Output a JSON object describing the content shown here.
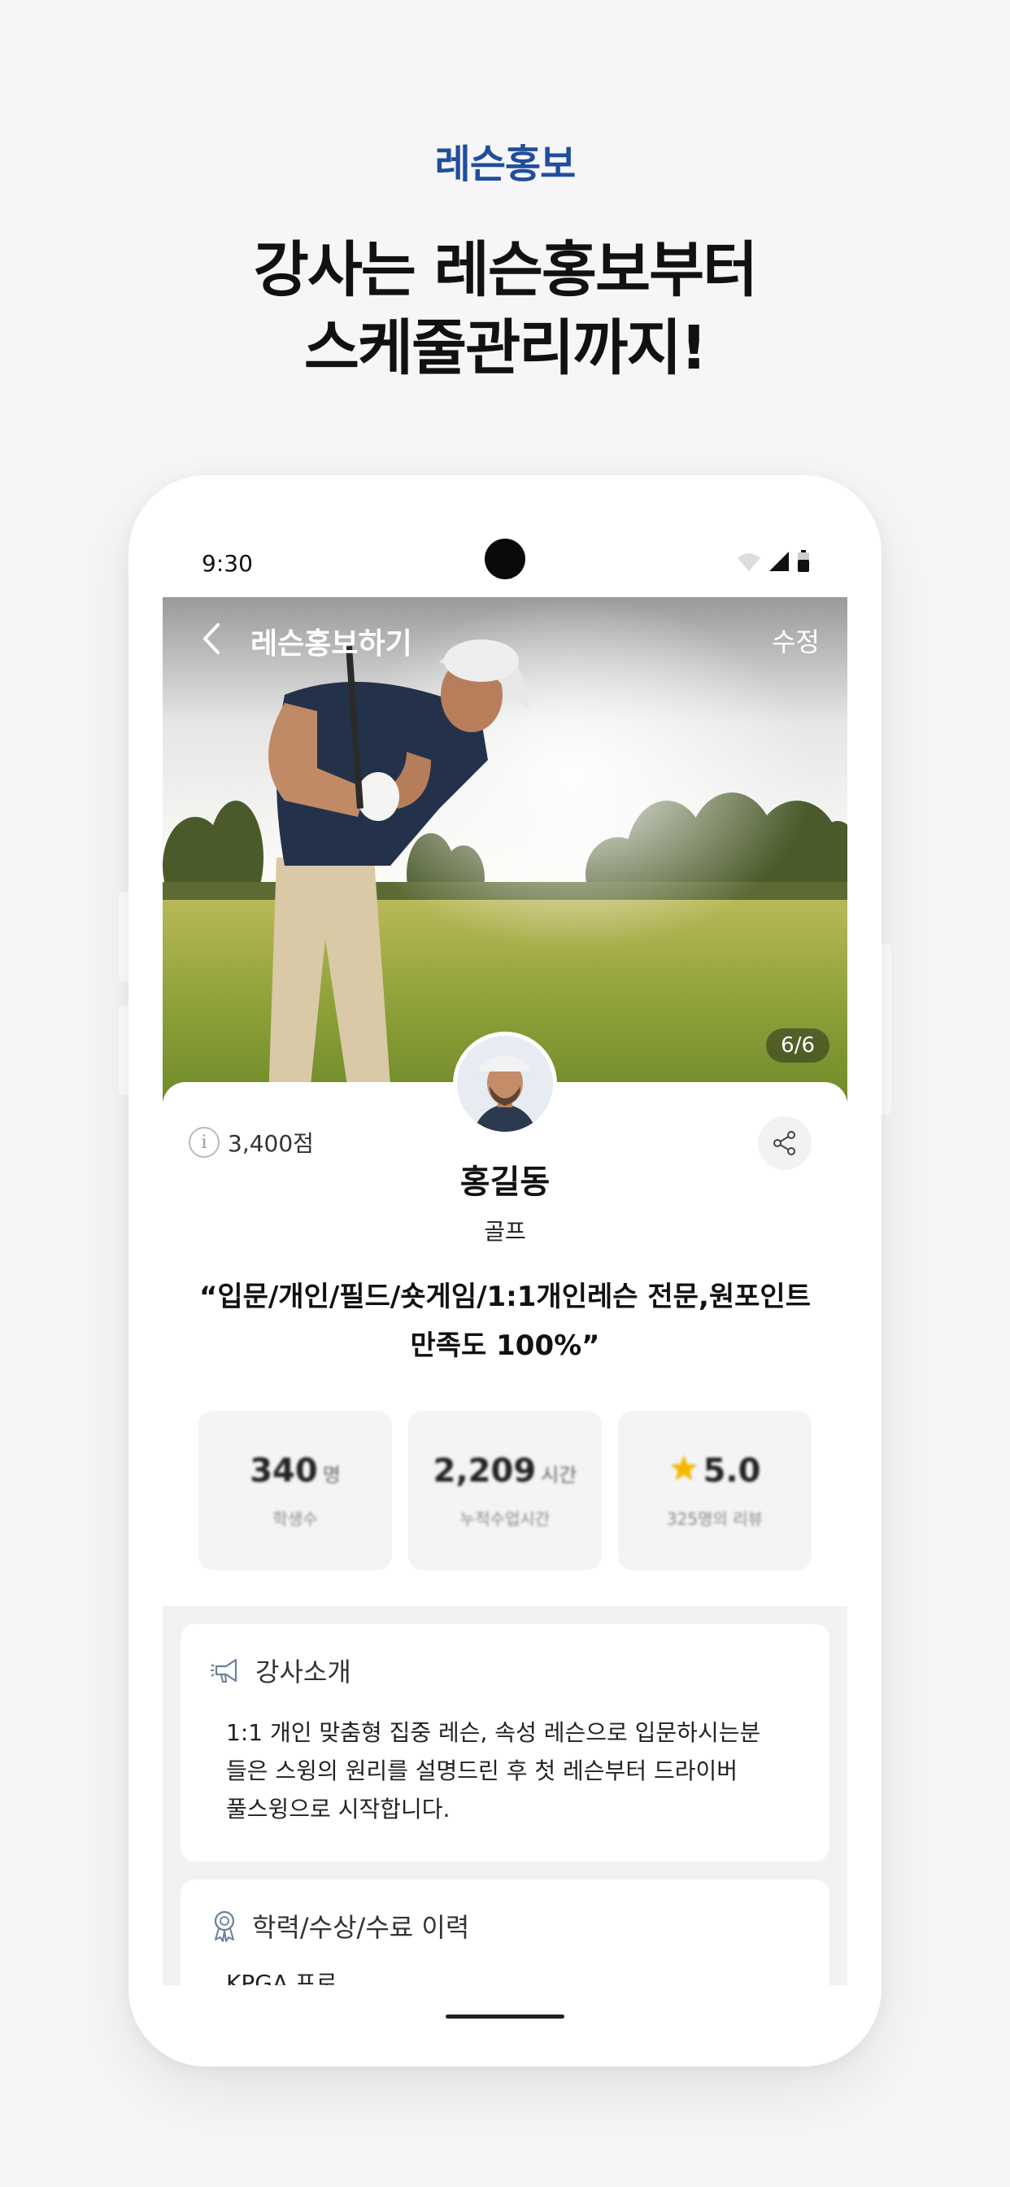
{
  "promo": {
    "eyebrow": "레슨홍보",
    "headline_line1": "강사는 레슨홍보부터",
    "headline_line2": "스케줄관리까지!"
  },
  "status_bar": {
    "time": "9:30"
  },
  "nav": {
    "title": "레슨홍보하기",
    "edit_label": "수정"
  },
  "hero": {
    "image_counter": "6/6"
  },
  "profile": {
    "points": "3,400점",
    "name": "홍길동",
    "category": "골프",
    "headline_line1": "“입문/개인/필드/숏게임/1:1개인레슨 전문,원포인트",
    "headline_line2": "만족도 100%”"
  },
  "stats": [
    {
      "value": "340",
      "unit": "명",
      "label": "학생수"
    },
    {
      "value": "2,209",
      "unit": "시간",
      "label": "누적수업시간"
    },
    {
      "value": "5.0",
      "unit": "",
      "label": "325명의 리뷰",
      "icon": "star-icon"
    }
  ],
  "sections": {
    "intro": {
      "title": "강사소개",
      "icon": "megaphone-icon",
      "line1": "1:1 개인 맞춤형 집중 레슨, 속성 레슨으로 입문하시는분",
      "line2": "들은 스윙의 원리를 설명드린 후 첫 레슨부터 드라이버",
      "line3": "풀스윙으로 시작합니다."
    },
    "history": {
      "title": "학력/수상/수료 이력",
      "icon": "award-ribbon-icon",
      "first_item": "KPGA 프로"
    }
  },
  "colors": {
    "accent": "#1f4e9c",
    "background": "#f6f6f8",
    "star": "#f5b800"
  }
}
